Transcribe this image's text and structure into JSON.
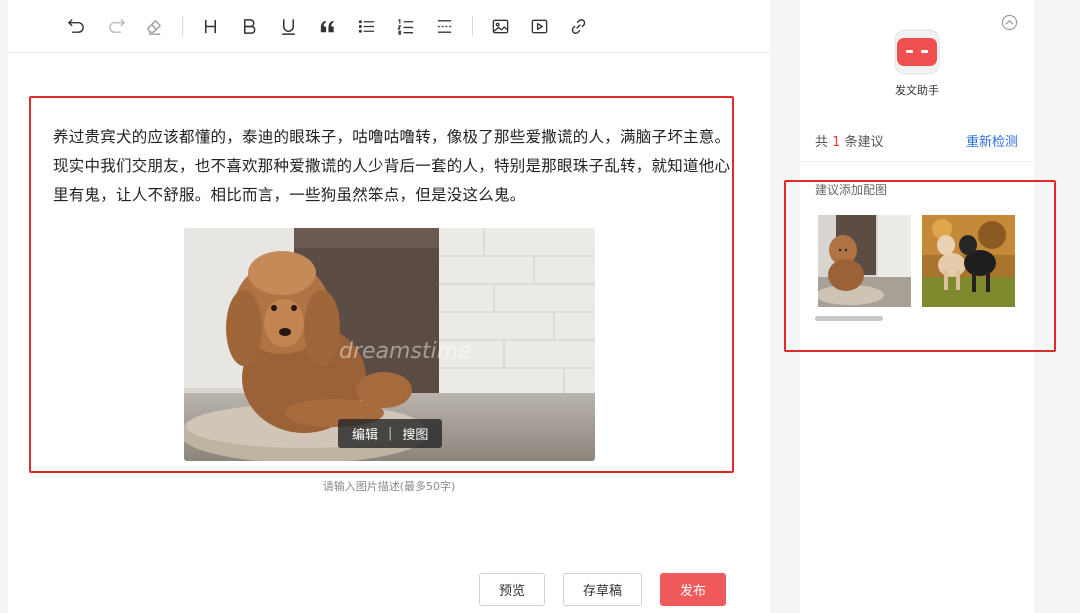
{
  "toolbar": {
    "icons": [
      "undo-icon",
      "redo-icon",
      "eraser-icon",
      "heading-icon",
      "bold-icon",
      "underline-icon",
      "quote-icon",
      "bullet-list-icon",
      "numbered-list-icon",
      "divider-icon",
      "image-icon",
      "video-icon",
      "link-icon"
    ]
  },
  "article": {
    "paragraph": "养过贵宾犬的应该都懂的，泰迪的眼珠子，咕噜咕噜转，像极了那些爱撒谎的人，满脑子坏主意。现实中我们交朋友，也不喜欢那种爱撒谎的人少背后一套的人，特别是那眼珠子乱转，就知道他心里有鬼，让人不舒服。相比而言，一些狗虽然笨点，但是没这么鬼。",
    "image_watermark": "dreamstime",
    "image_actions": {
      "edit": "编辑",
      "separator": "|",
      "search": "搜图"
    },
    "image_caption_placeholder": "请输入图片描述(最多50字)"
  },
  "actions": {
    "preview": "预览",
    "save_draft": "存草稿",
    "publish": "发布"
  },
  "sidebar": {
    "assistant_name": "发文助手",
    "count_prefix": "共",
    "count": "1",
    "count_suffix": "条建议",
    "recheck": "重新检测",
    "suggestion_title": "建议添加配图"
  },
  "colors": {
    "accent": "#f05a5a",
    "link": "#2f6fe0",
    "highlight": "#e12b2b"
  }
}
